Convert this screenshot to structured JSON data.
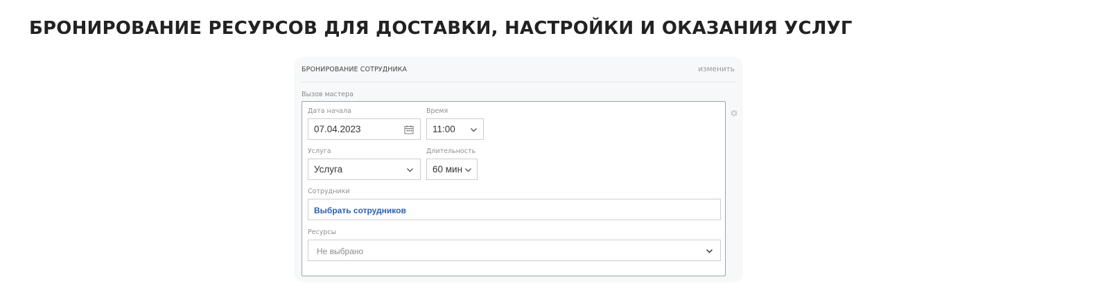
{
  "page": {
    "title": "БРОНИРОВАНИЕ РЕСУРСОВ ДЛЯ ДОСТАВКИ, НАСТРОЙКИ И ОКАЗАНИЯ УСЛУГ"
  },
  "panel": {
    "title": "БРОНИРОВАНИЕ СОТРУДНИКА",
    "edit_label": "изменить",
    "section_label": "Вызов мастера",
    "icons": {
      "settings": "gear-icon",
      "calendar": "calendar-icon",
      "dropdown": "chevron-down-icon"
    }
  },
  "form": {
    "start_date": {
      "label": "Дата начала",
      "value": "07.04.2023"
    },
    "time": {
      "label": "Время",
      "value": "11:00"
    },
    "service": {
      "label": "Услуга",
      "value": "Услуга"
    },
    "duration": {
      "label": "Длительность",
      "value": "60 мин"
    },
    "employees": {
      "label": "Сотрудники",
      "link": "Выбрать сотрудников"
    },
    "resources": {
      "label": "Ресурсы",
      "value": "Не выбрано"
    }
  },
  "colors": {
    "link": "#2a5fac",
    "panel_background": "#f7f8f9",
    "title": "#222222"
  }
}
